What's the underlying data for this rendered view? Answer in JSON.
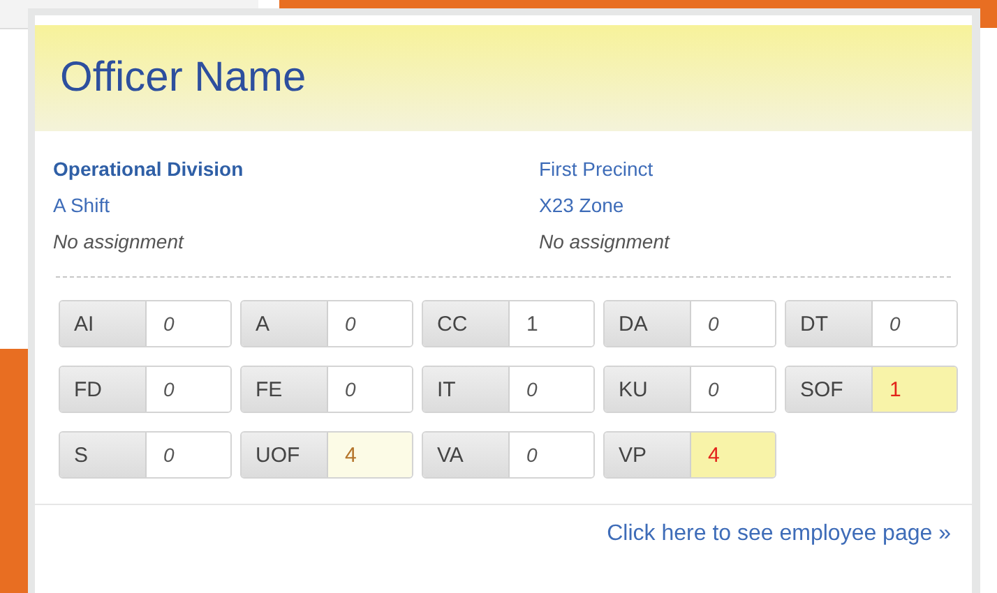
{
  "card": {
    "title": "Officer Name",
    "details_left": [
      {
        "text": "Operational Division",
        "kind": "heading"
      },
      {
        "text": "A Shift",
        "kind": "link"
      },
      {
        "text": "No assignment",
        "kind": "note"
      }
    ],
    "details_right": [
      {
        "text": "First Precinct",
        "kind": "link"
      },
      {
        "text": "X23 Zone",
        "kind": "link"
      },
      {
        "text": "No assignment",
        "kind": "note"
      }
    ],
    "counters": [
      {
        "label": "AI",
        "value": "0",
        "muted": true,
        "kind": "normal"
      },
      {
        "label": "A",
        "value": "0",
        "muted": true,
        "kind": "normal"
      },
      {
        "label": "CC",
        "value": "1",
        "muted": false,
        "kind": "normal"
      },
      {
        "label": "DA",
        "value": "0",
        "muted": true,
        "kind": "normal"
      },
      {
        "label": "DT",
        "value": "0",
        "muted": true,
        "kind": "normal"
      },
      {
        "label": "FD",
        "value": "0",
        "muted": true,
        "kind": "normal"
      },
      {
        "label": "FE",
        "value": "0",
        "muted": true,
        "kind": "normal"
      },
      {
        "label": "IT",
        "value": "0",
        "muted": true,
        "kind": "normal"
      },
      {
        "label": "KU",
        "value": "0",
        "muted": true,
        "kind": "normal"
      },
      {
        "label": "SOF",
        "value": "1",
        "muted": false,
        "kind": "warning"
      },
      {
        "label": "S",
        "value": "0",
        "muted": true,
        "kind": "normal"
      },
      {
        "label": "UOF",
        "value": "4",
        "muted": false,
        "kind": "notice"
      },
      {
        "label": "VA",
        "value": "0",
        "muted": true,
        "kind": "normal"
      },
      {
        "label": "VP",
        "value": "4",
        "muted": false,
        "kind": "warning"
      }
    ],
    "footer_link": "Click here to see employee page »"
  }
}
